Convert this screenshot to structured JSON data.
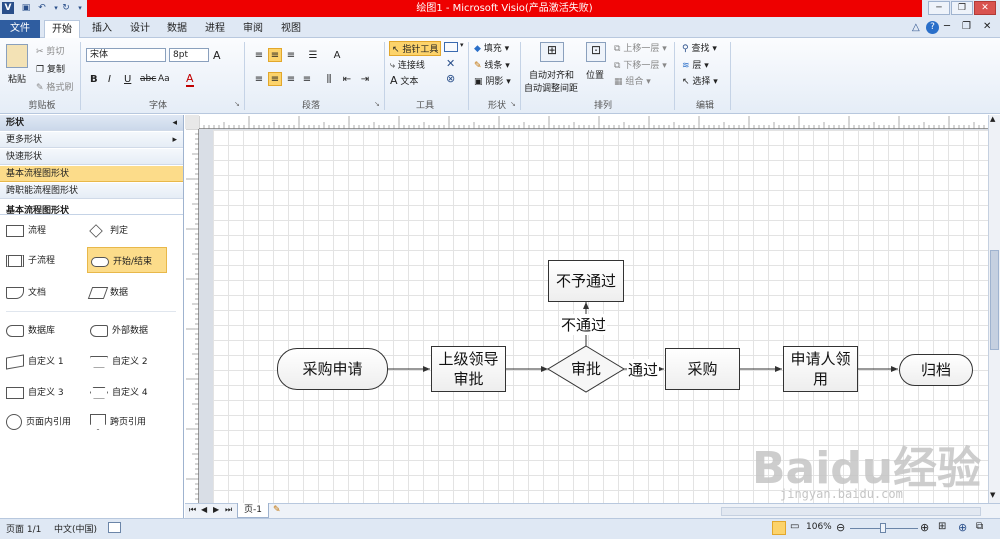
{
  "window": {
    "title": "绘图1 - Microsoft Visio(产品激活失败)",
    "qat_icons": [
      "visio-logo-icon",
      "save-icon",
      "undo-icon",
      "redo-icon"
    ]
  },
  "tabs": {
    "file": "文件",
    "home": "开始",
    "insert": "插入",
    "design": "设计",
    "data": "数据",
    "process": "进程",
    "review": "审阅",
    "view": "视图"
  },
  "ribbon": {
    "clipboard": {
      "paste": "粘贴",
      "cut": "剪切",
      "copy": "复制",
      "format_painter": "格式刷",
      "group": "剪贴板"
    },
    "font": {
      "family": "宋体",
      "size": "8pt",
      "bold": "B",
      "italic": "I",
      "underline": "U",
      "strike": "abc",
      "case": "Aa",
      "color": "A",
      "grow": "A",
      "group": "字体"
    },
    "paragraph": {
      "group": "段落"
    },
    "tools": {
      "pointer": "指针工具",
      "connector": "连接线",
      "text": "文本",
      "group": "工具"
    },
    "shape": {
      "fill": "填充",
      "line": "线条",
      "shadow": "阴影",
      "group": "形状"
    },
    "arrange": {
      "auto_align": "自动对齐和",
      "auto_space": "自动调整间距",
      "position": "位置",
      "bring_forward": "上移一层",
      "send_backward": "下移一层",
      "group_btn": "组合",
      "group": "排列"
    },
    "editing": {
      "find": "查找",
      "layers": "层",
      "select": "选择",
      "group": "编辑"
    }
  },
  "shapes_panel": {
    "header": "形状",
    "rows": [
      "更多形状",
      "快速形状",
      "基本流程图形状",
      "跨职能流程图形状"
    ],
    "stencil_title": "基本流程图形状",
    "items": [
      "流程",
      "判定",
      "子流程",
      "开始/结束",
      "文档",
      "数据",
      "数据库",
      "外部数据",
      "自定义 1",
      "自定义 2",
      "自定义 3",
      "自定义 4",
      "页面内引用",
      "跨页引用"
    ]
  },
  "diagram": {
    "start": "采购申请",
    "approval_leader": "上级领导审批",
    "decision": "审批",
    "reject_box": "不予通过",
    "reject_label": "不通过",
    "pass_label": "通过",
    "purchase": "采购",
    "applicant_receive": "申请人领用",
    "archive": "归档"
  },
  "page_tabs": {
    "page1": "页-1"
  },
  "statusbar": {
    "page": "页面 1/1",
    "language": "中文(中国)",
    "zoom": "106%"
  },
  "watermark": {
    "brand": "Baidu经验",
    "url": "jingyan.baidu.com"
  }
}
